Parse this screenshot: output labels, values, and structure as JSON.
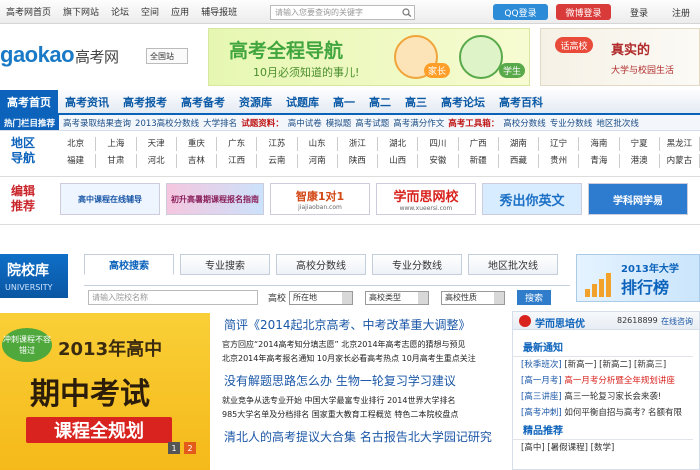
{
  "topbar": {
    "nav": [
      "高考网首页",
      "旗下网站",
      "论坛",
      "空间",
      "应用",
      "辅导报班"
    ],
    "search_placeholder": "请输入您要查询的关键字",
    "qq_login": "QQ登录",
    "weibo_login": "微博登录",
    "login": "登录",
    "register": "注册"
  },
  "header": {
    "logo_en": "gaokao",
    "logo_cn": "高考网",
    "site_select": "全国站",
    "banner1_title": "高考全程导航",
    "banner1_sub": "10月必须知道的事儿!",
    "banner1_tag1": "家长",
    "banner1_tag2": "学生",
    "banner2_badge": "话高校",
    "banner2_title": "真实的",
    "banner2_sub": "大学与校园生活"
  },
  "mainnav": [
    "高考首页",
    "高考资讯",
    "高考报考",
    "高考备考",
    "资源库",
    "试题库",
    "高一",
    "高二",
    "高三",
    "高考论坛",
    "高考百科"
  ],
  "hotrow": {
    "label": "热门栏目推荐",
    "items": [
      "高考录取结果查询",
      "2013高校分数线",
      "大学排名"
    ],
    "res_label": "试题资料：",
    "res_items": [
      "高中试卷",
      "模拟题",
      "高考试题",
      "高考满分作文"
    ],
    "tool_label": "高考工具箱：",
    "tool_items": [
      "高校分数线",
      "专业分数线",
      "地区批次线"
    ]
  },
  "region": {
    "label": "地区导航",
    "row1": [
      "北京",
      "上海",
      "天津",
      "重庆",
      "广东",
      "江苏",
      "山东",
      "浙江",
      "湖北",
      "四川",
      "广西",
      "湖南",
      "辽宁",
      "海南",
      "宁夏",
      "黑龙江"
    ],
    "row2": [
      "福建",
      "甘肃",
      "河北",
      "吉林",
      "江西",
      "云南",
      "河南",
      "陕西",
      "山西",
      "安徽",
      "新疆",
      "西藏",
      "贵州",
      "青海",
      "港澳",
      "内蒙古"
    ]
  },
  "recommend": {
    "label": "编辑推荐",
    "ads": [
      "高中课程在线辅导",
      "初升高暑期课程报名指南",
      "智康1对1",
      "学而思网校",
      "秀出你英文",
      "学科网学易"
    ],
    "ad_sub": [
      "",
      "",
      "jiajiaoban.com",
      "www.xueersi.com",
      "",
      ""
    ]
  },
  "university": {
    "logo": "院校库",
    "logo_en": "UNIVERSITY",
    "tabs": [
      "高校搜索",
      "专业搜索",
      "高校分数线",
      "专业分数线",
      "地区批次线"
    ],
    "name_placeholder": "请输入院校名称",
    "label": "高校",
    "sel1": "所在地",
    "sel2": "高校类型",
    "sel3": "高校性质",
    "search_btn": "搜索",
    "rank_year": "2013年大学",
    "rank_title": "排行榜"
  },
  "bigbanner": {
    "tag": "冲刺课程不容错过",
    "year": "2013年高中",
    "main": "期中考试",
    "sub": "课程全规划",
    "page1": "1",
    "page2": "2"
  },
  "news": {
    "head1": "简评《2014起北京高考、中考改革重大调整》",
    "l1": "官方回应“2014高考知分填志愿”  北京2014年高考志愿的猜想与预见",
    "l2": "北京2014年高考报名通知  10月家长必看高考热点  10月高考生重点关注",
    "head2": "没有解题思路怎么办  生物一轮复习学习建议",
    "l3": "就业竞争从选专业开始  中国大学最富专业排行  2014世界大学排名",
    "l4": "985大学名单及分档排名  国家重大教育工程概览  特色二本院校盘点",
    "head3": "清北人的高考提议大合集  名古报告北大学园记研究"
  },
  "rside": {
    "header": "学而思培优",
    "phone": "82618899",
    "online": "在线咨询",
    "notice_title": "最新通知",
    "items": [
      {
        "k": "[秋季班次]",
        "v": "[新高一] [新高二] [新高三]"
      },
      {
        "k": "[高一月考]",
        "v": "高一月考分析暨全年规划讲座"
      },
      {
        "k": "[高三讲座]",
        "v": "高三一轮复习家长会来袭!"
      },
      {
        "k": "[高考冲刺]",
        "v": "如何平衡自招与高考? 名额有限"
      }
    ],
    "featured_title": "精品推荐",
    "f1": "[高中] [暑假课程] [数学]"
  }
}
